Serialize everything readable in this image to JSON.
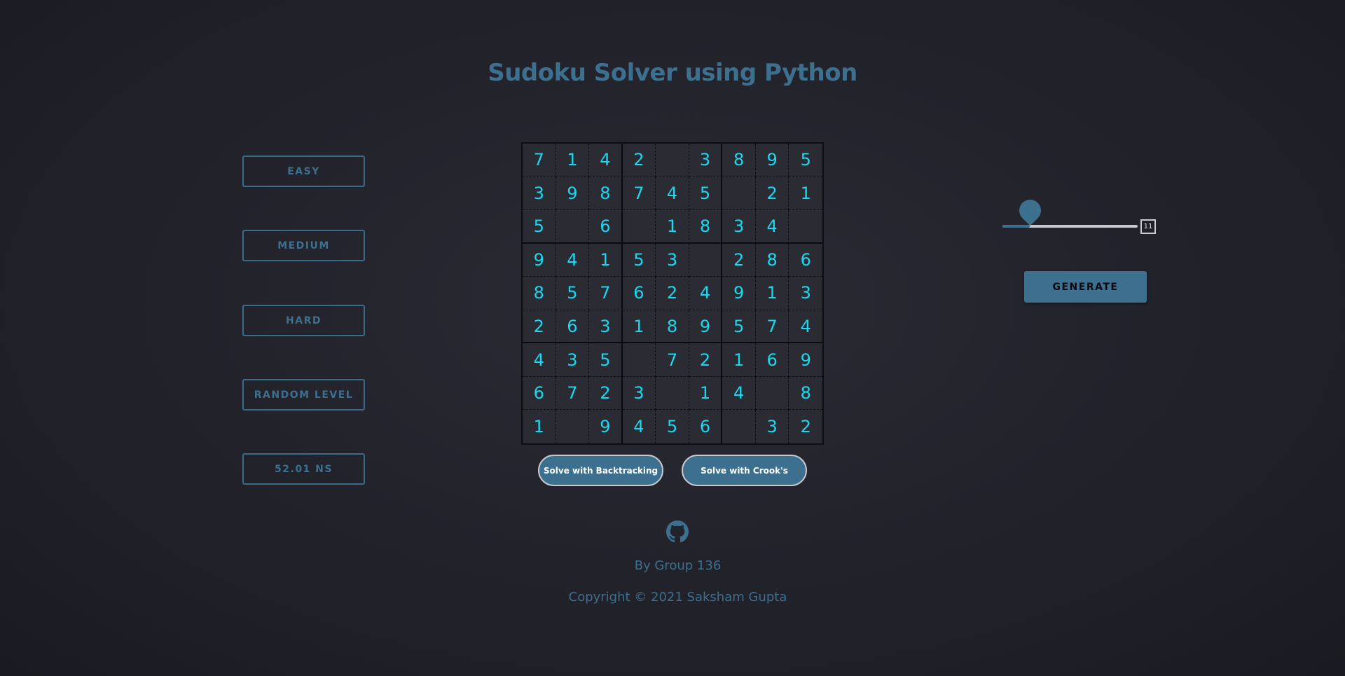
{
  "title": "Sudoku Solver using Python",
  "levels": {
    "easy": "EASY",
    "medium": "MEDIUM",
    "hard": "HARD",
    "random": "RANDOM LEVEL",
    "time": "52.01 NS"
  },
  "board": [
    [
      "7",
      "1",
      "4",
      "2",
      "",
      "3",
      "8",
      "9",
      "5"
    ],
    [
      "3",
      "9",
      "8",
      "7",
      "4",
      "5",
      "",
      "2",
      "1"
    ],
    [
      "5",
      "",
      "6",
      "",
      "1",
      "8",
      "3",
      "4",
      ""
    ],
    [
      "9",
      "4",
      "1",
      "5",
      "3",
      "",
      "2",
      "8",
      "6"
    ],
    [
      "8",
      "5",
      "7",
      "6",
      "2",
      "4",
      "9",
      "1",
      "3"
    ],
    [
      "2",
      "6",
      "3",
      "1",
      "8",
      "9",
      "5",
      "7",
      "4"
    ],
    [
      "4",
      "3",
      "5",
      "",
      "7",
      "2",
      "1",
      "6",
      "9"
    ],
    [
      "6",
      "7",
      "2",
      "3",
      "",
      "1",
      "4",
      "",
      "8"
    ],
    [
      "1",
      "",
      "9",
      "4",
      "5",
      "6",
      "",
      "3",
      "2"
    ]
  ],
  "solve": {
    "backtracking": "Solve with Backtracking",
    "crook": "Solve with Crook's"
  },
  "slider": {
    "value": "11",
    "fraction": 0.2
  },
  "generate_label": "GENERATE",
  "footer": {
    "github_icon": "github-icon",
    "byline": "By Group 136",
    "copyright": "Copyright © 2021 Saksham Gupta"
  },
  "colors": {
    "accent": "#3d6f8e",
    "digit": "#19d8f0",
    "background": "#23232c"
  }
}
